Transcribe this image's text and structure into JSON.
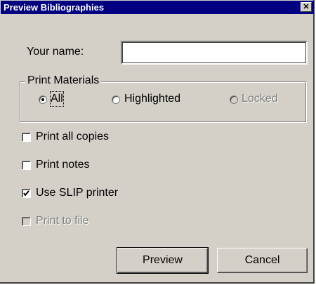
{
  "window": {
    "title": "Preview Bibliographies",
    "close_glyph": "✕"
  },
  "name_field": {
    "label": "Your name:",
    "value": ""
  },
  "print_materials": {
    "group_label": "Print Materials",
    "options": [
      {
        "label": "All",
        "selected": true,
        "enabled": true
      },
      {
        "label": "Highlighted",
        "selected": false,
        "enabled": true
      },
      {
        "label": "Locked",
        "selected": false,
        "enabled": false
      }
    ]
  },
  "checkboxes": [
    {
      "label": "Print all copies",
      "checked": false,
      "enabled": true
    },
    {
      "label": "Print notes",
      "checked": false,
      "enabled": true
    },
    {
      "label": "Use SLIP printer",
      "checked": true,
      "enabled": true
    },
    {
      "label": "Print to file",
      "checked": false,
      "enabled": false
    }
  ],
  "buttons": {
    "preview": "Preview",
    "cancel": "Cancel"
  },
  "colors": {
    "face": "#d4d0c8",
    "titlebar": "#000080",
    "disabled_text": "#808080"
  },
  "icons": {
    "close": "close-icon",
    "check": "checkmark-icon"
  }
}
